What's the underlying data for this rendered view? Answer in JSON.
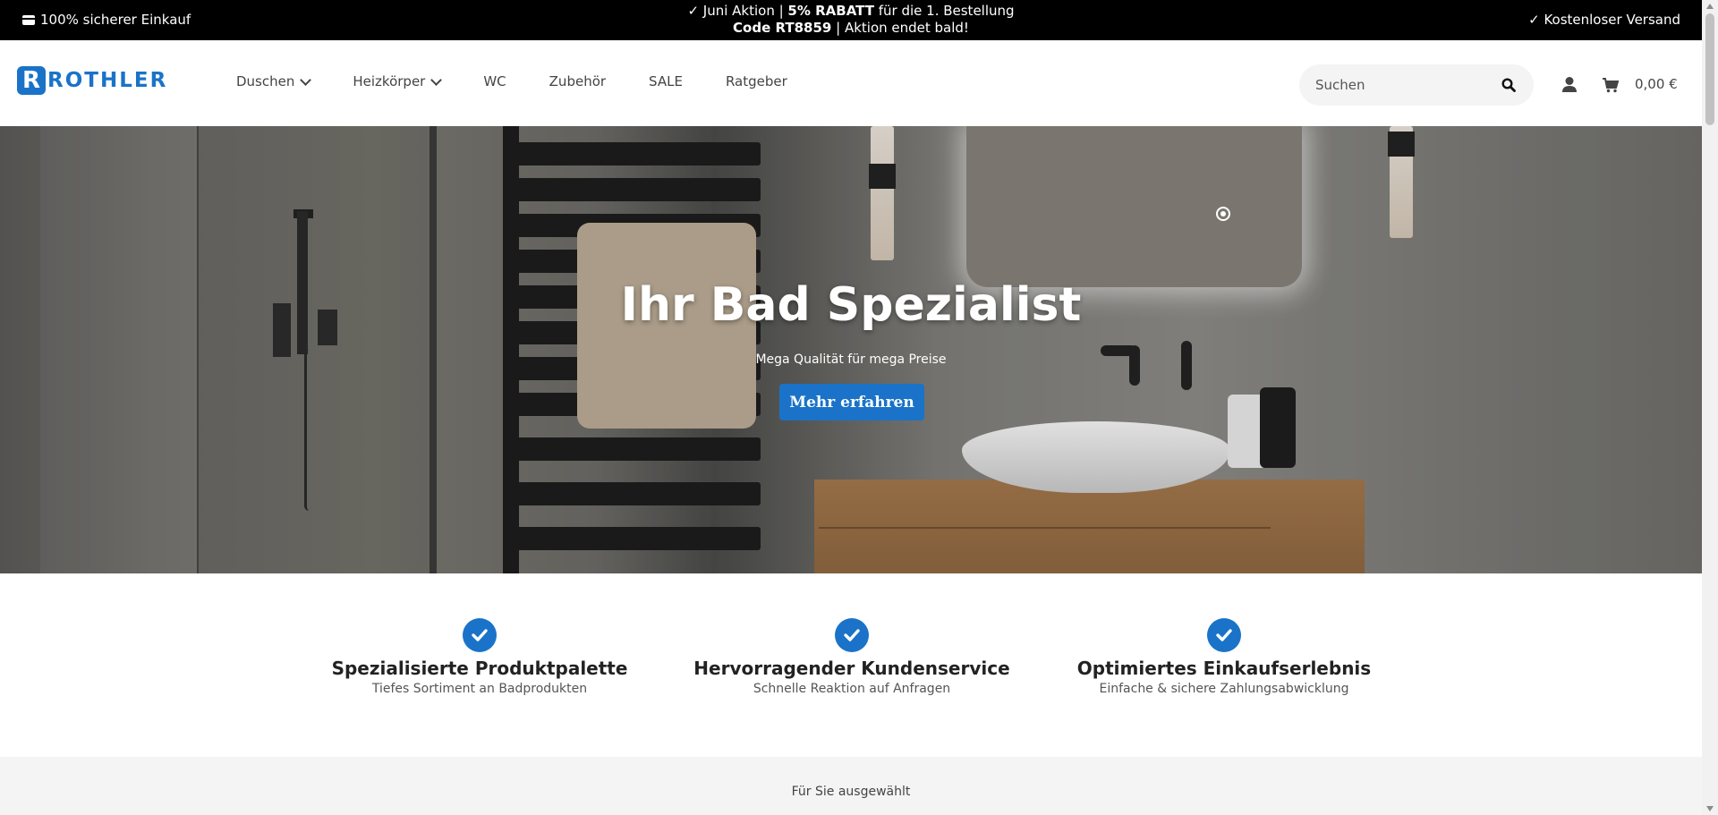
{
  "topbar": {
    "left_text": "100% sicherer Einkauf",
    "line1_prefix": "✓ Juni Aktion | ",
    "line1_bold": "5% RABATT",
    "line1_suffix": " für die 1. Bestellung",
    "line2_bold": "Code RT8859",
    "line2_suffix": " | Aktion endet bald!",
    "right_text": "✓ Kostenloser Versand"
  },
  "header": {
    "logo_letter": "R",
    "logo_text": "ROTHLER",
    "nav": [
      {
        "label": "Duschen",
        "dropdown": true
      },
      {
        "label": "Heizkörper",
        "dropdown": true
      },
      {
        "label": "WC",
        "dropdown": false
      },
      {
        "label": "Zubehör",
        "dropdown": false
      },
      {
        "label": "SALE",
        "dropdown": false
      },
      {
        "label": "Ratgeber",
        "dropdown": false
      }
    ],
    "search_placeholder": "Suchen",
    "cart_amount": "0,00 €"
  },
  "hero": {
    "title": "Ihr Bad Spezialist",
    "subtitle": "Mega Qualität für mega Preise",
    "button": "Mehr erfahren"
  },
  "features": [
    {
      "title": "Spezialisierte Produktpalette",
      "sub": "Tiefes Sortiment an Badprodukten"
    },
    {
      "title": "Hervorragender Kundenservice",
      "sub": "Schnelle Reaktion auf Anfragen"
    },
    {
      "title": "Optimiertes Einkaufserlebnis",
      "sub": "Einfache & sichere Zahlungsabwicklung"
    }
  ],
  "selected_section": {
    "label": "Für Sie ausgewählt"
  },
  "colors": {
    "brand": "#1a73c8",
    "topbar_bg": "#000000"
  }
}
